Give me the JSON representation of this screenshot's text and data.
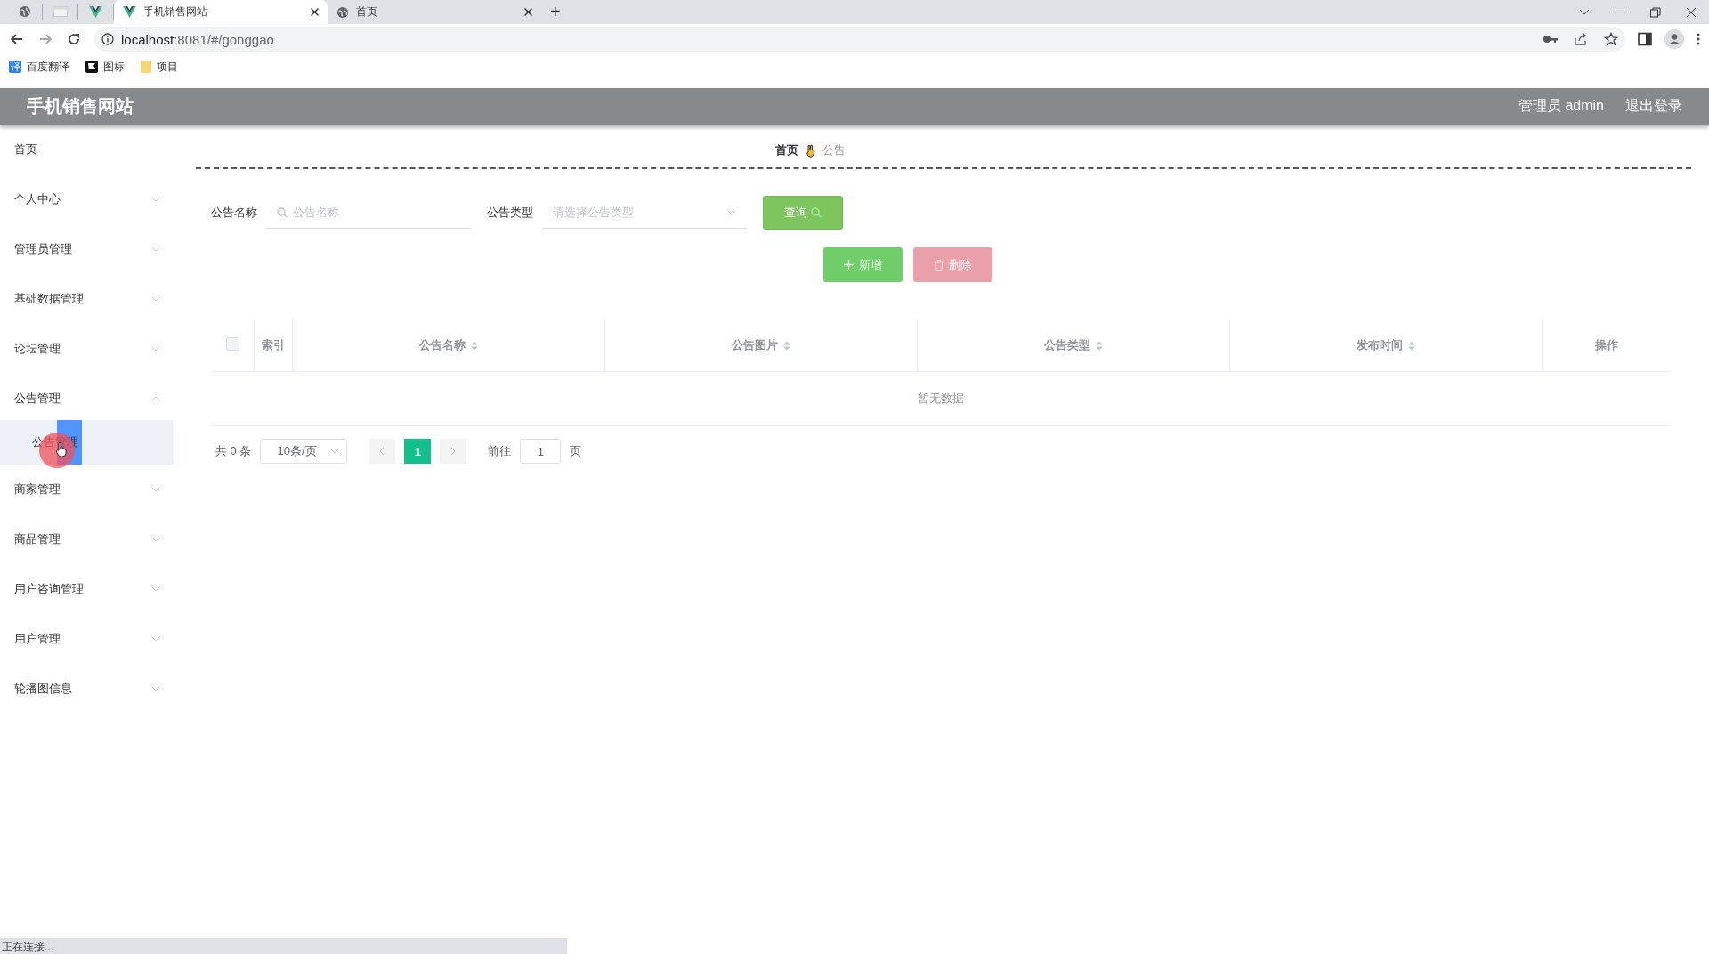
{
  "browser": {
    "tabs": [
      {
        "kind": "pinned",
        "selected": false
      },
      {
        "kind": "pinned",
        "selected": false
      },
      {
        "kind": "pinned",
        "selected": false
      },
      {
        "kind": "full",
        "title": "手机销售网站",
        "selected": true
      },
      {
        "kind": "full",
        "title": "首页",
        "selected": false
      }
    ],
    "new_tab": "+",
    "url": {
      "host": "localhost",
      "rest": ":8081/#/gonggao"
    },
    "bookmarks": [
      {
        "glyph": "译",
        "label": "百度翻译"
      },
      {
        "label": "图标"
      },
      {
        "label": "项目"
      }
    ],
    "status": "正在连接..."
  },
  "header": {
    "title": "手机销售网站",
    "user": "管理员 admin",
    "logout": "退出登录"
  },
  "sidebar": {
    "items": [
      {
        "kind": "link",
        "label": "首页"
      },
      {
        "kind": "group",
        "label": "个人中心",
        "expanded": false
      },
      {
        "kind": "group",
        "label": "管理员管理",
        "expanded": false
      },
      {
        "kind": "group",
        "label": "基础数据管理",
        "expanded": false
      },
      {
        "kind": "group",
        "label": "论坛管理",
        "expanded": false
      },
      {
        "kind": "group",
        "label": "公告管理",
        "expanded": true,
        "children": [
          {
            "label": "公告管理",
            "selected": true
          }
        ]
      },
      {
        "kind": "group",
        "label": "商家管理",
        "expanded": false
      },
      {
        "kind": "group",
        "label": "商品管理",
        "expanded": false
      },
      {
        "kind": "group",
        "label": "用户咨询管理",
        "expanded": false
      },
      {
        "kind": "group",
        "label": "用户管理",
        "expanded": false
      },
      {
        "kind": "group",
        "label": "轮播图信息",
        "expanded": false
      }
    ]
  },
  "breadcrumb": [
    {
      "label": "首页",
      "current": false
    },
    {
      "label": "公告",
      "current": true
    }
  ],
  "search": {
    "fields": [
      {
        "kind": "input",
        "label": "公告名称",
        "placeholder": "公告名称"
      },
      {
        "kind": "select",
        "label": "公告类型",
        "placeholder": "请选择公告类型"
      }
    ],
    "query_button": "查询"
  },
  "actions": [
    {
      "kind": "add",
      "label": "新增",
      "disabled": false
    },
    {
      "kind": "delete",
      "label": "删除",
      "disabled": true
    }
  ],
  "table": {
    "select_all_checked": false,
    "columns": [
      {
        "kind": "check"
      },
      {
        "label": "索引",
        "sortable": false
      },
      {
        "label": "公告名称",
        "sortable": true
      },
      {
        "label": "公告图片",
        "sortable": true
      },
      {
        "label": "公告类型",
        "sortable": true
      },
      {
        "label": "发布时间",
        "sortable": true
      },
      {
        "label": "操作",
        "sortable": false
      }
    ],
    "empty": "暂无数据"
  },
  "pagination": {
    "total": "共 0 条",
    "page_size": "10条/页",
    "pages": [
      {
        "label": "1",
        "selected": true
      }
    ],
    "goto_label": "前往",
    "goto_value": "1",
    "goto_suffix": "页"
  }
}
